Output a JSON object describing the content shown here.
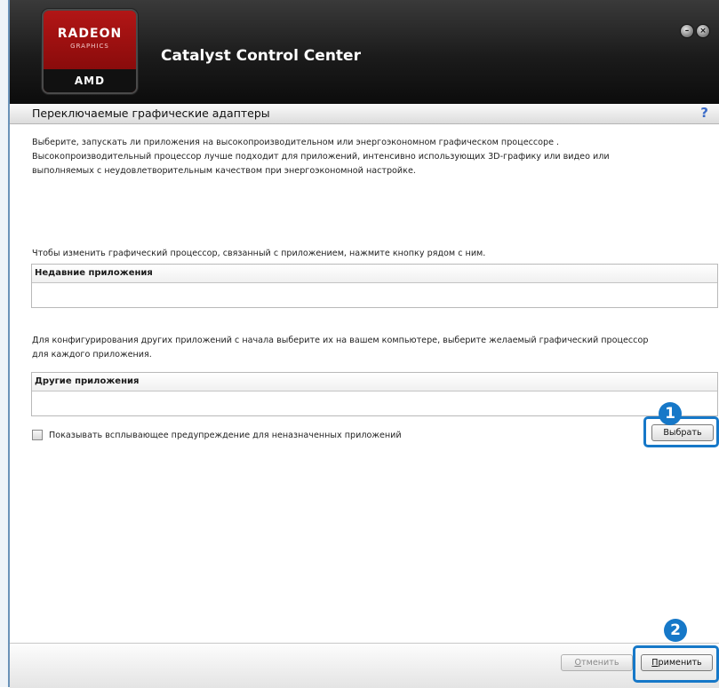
{
  "window": {
    "title": "Catalyst Control Center"
  },
  "logo": {
    "line1": "RADEON",
    "line2": "GRAPHICS",
    "brand": "AMD"
  },
  "controls": {
    "minimize_icon": "minimize-icon",
    "close_icon": "close-icon"
  },
  "section": {
    "title": "Переключаемые графические адаптеры",
    "help_label": "?"
  },
  "description": [
    "Выберите, запускать ли приложения на высокопроизводительном или энергоэкономном графическом процессоре .",
    "Высокопроизводительный процессор лучше подходит для приложений, интенсивно использующих 3D-графику или видео или",
    "выполняемых с неудовлетворительным качеством при энергоэкономной настройке."
  ],
  "recent": {
    "instruction": "Чтобы изменить графический процессор, связанный с приложением, нажмите кнопку рядом с ним.",
    "header": "Недавние приложения"
  },
  "other": {
    "instruction": [
      "Для конфигурирования других приложений с начала выберите их на вашем компьютере, выберите желаемый графический процессор",
      "для каждого приложения."
    ],
    "header": "Другие приложения",
    "browse_label": "Выбрать"
  },
  "warning_checkbox": {
    "label": "Показывать всплывающее предупреждение для неназначенных приложений",
    "checked": false
  },
  "footer": {
    "cancel_first": "О",
    "cancel_rest": "тменить",
    "apply_first": "П",
    "apply_rest": "рименить"
  },
  "annotations": {
    "badge1": "1",
    "badge2": "2",
    "color": "#1678c8"
  },
  "colors": {
    "title_bar": "#1b1b1b",
    "radeon_red": "#b21616",
    "link_blue": "#3a6bc8"
  }
}
